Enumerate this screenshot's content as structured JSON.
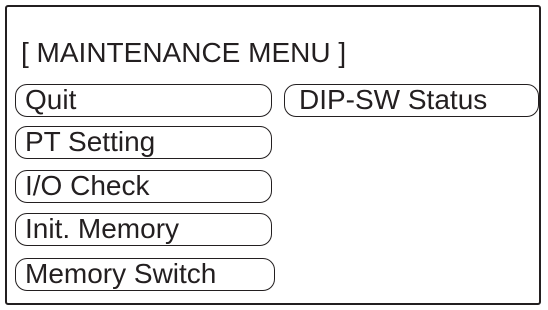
{
  "menu": {
    "title": "[ MAINTENANCE MENU ]",
    "buttons": {
      "quit": "Quit",
      "dip_sw_status": "DIP-SW Status",
      "pt_setting": "PT Setting",
      "io_check": "I/O Check",
      "init_memory": "Init. Memory",
      "memory_switch": "Memory Switch"
    }
  }
}
